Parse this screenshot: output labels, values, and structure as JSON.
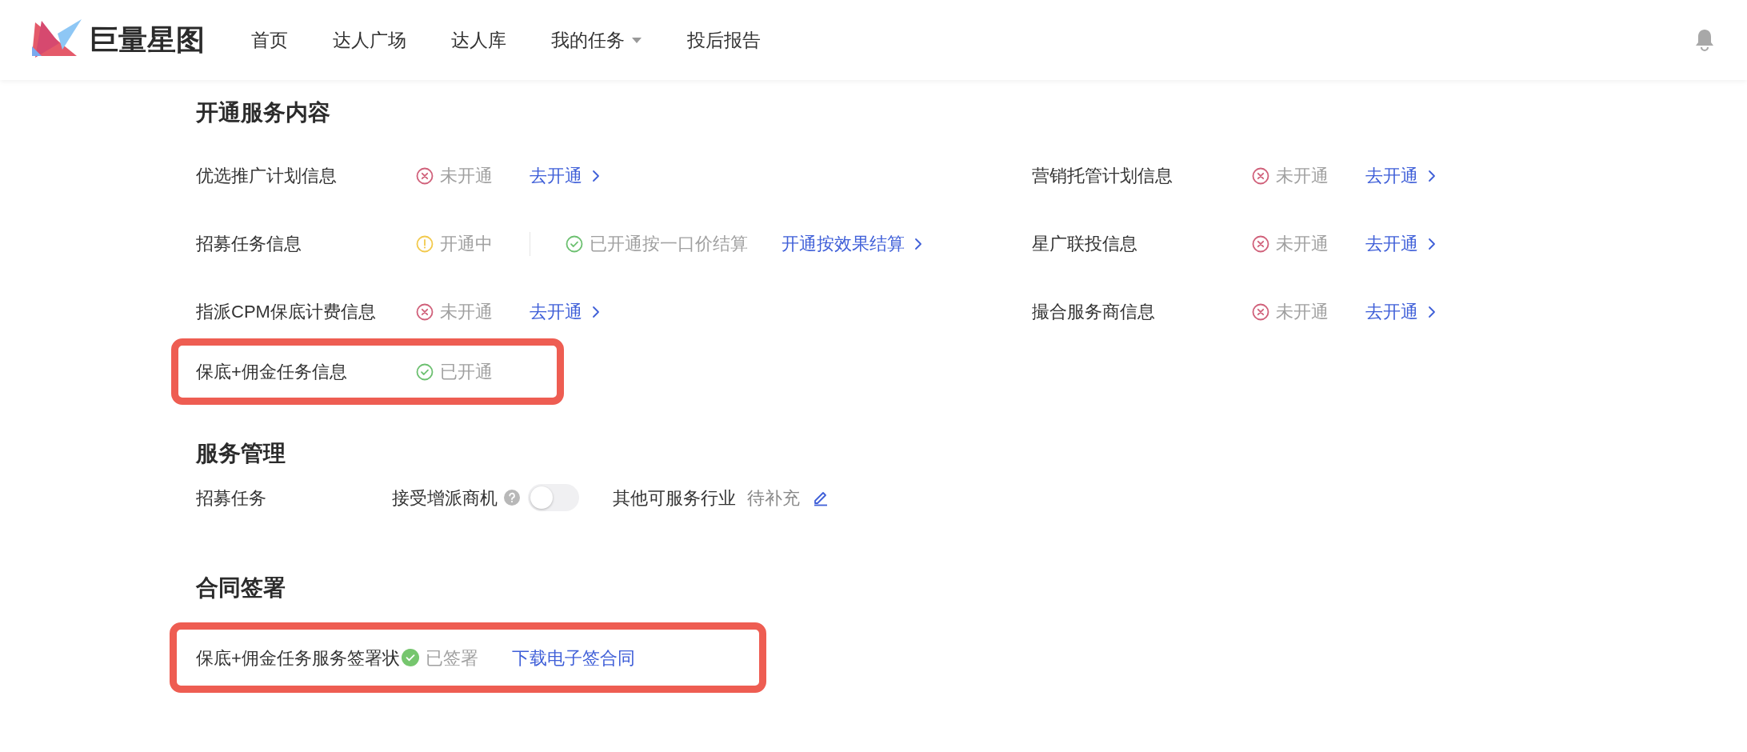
{
  "header": {
    "logo_text": "巨量星图",
    "nav": [
      {
        "label": "首页",
        "dropdown": false
      },
      {
        "label": "达人广场",
        "dropdown": false
      },
      {
        "label": "达人库",
        "dropdown": false
      },
      {
        "label": "我的任务",
        "dropdown": true
      },
      {
        "label": "投后报告",
        "dropdown": false
      }
    ]
  },
  "service_content": {
    "title": "开通服务内容",
    "left_rows": [
      {
        "label": "优选推广计划信息",
        "highlighted": false,
        "statuses": [
          {
            "kind": "not_open",
            "text": "未开通"
          }
        ],
        "link": "去开通"
      },
      {
        "label": "招募任务信息",
        "highlighted": false,
        "statuses": [
          {
            "kind": "pending",
            "text": "开通中"
          },
          {
            "kind": "open",
            "text": "已开通按一口价结算"
          }
        ],
        "link": "开通按效果结算"
      },
      {
        "label": "指派CPM保底计费信息",
        "highlighted": false,
        "statuses": [
          {
            "kind": "not_open",
            "text": "未开通"
          }
        ],
        "link": "去开通"
      },
      {
        "label": "保底+佣金任务信息",
        "highlighted": true,
        "statuses": [
          {
            "kind": "open",
            "text": "已开通"
          }
        ]
      }
    ],
    "right_rows": [
      {
        "label": "营销托管计划信息",
        "highlighted": false,
        "statuses": [
          {
            "kind": "not_open",
            "text": "未开通"
          }
        ],
        "link": "去开通"
      },
      {
        "label": "星广联投信息",
        "highlighted": false,
        "statuses": [
          {
            "kind": "not_open",
            "text": "未开通"
          }
        ],
        "link": "去开通"
      },
      {
        "label": "撮合服务商信息",
        "highlighted": false,
        "statuses": [
          {
            "kind": "not_open",
            "text": "未开通"
          }
        ],
        "link": "去开通"
      }
    ]
  },
  "service_management": {
    "title": "服务管理",
    "row_label": "招募任务",
    "toggle": {
      "label": "接受增派商机",
      "on": false
    },
    "industry": {
      "label": "其他可服务行业",
      "value": "待补充"
    }
  },
  "contract": {
    "title": "合同签署",
    "highlighted": true,
    "label": "保底+佣金任务服务签署状",
    "status": {
      "kind": "open",
      "text": "已签署"
    },
    "link": "下载电子签合同"
  }
}
